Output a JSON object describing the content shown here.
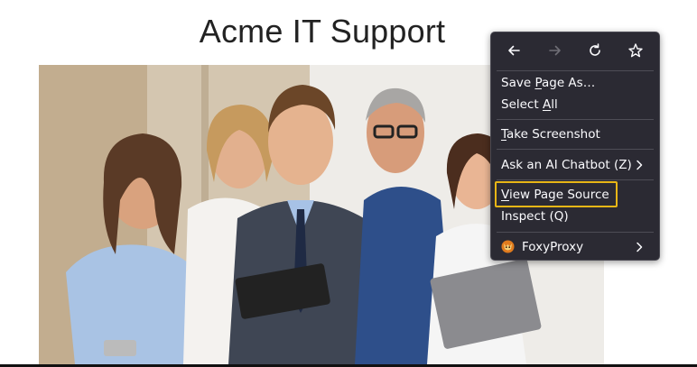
{
  "page": {
    "title": "Acme IT Support"
  },
  "context_menu": {
    "nav": [
      "back-icon",
      "forward-icon",
      "reload-icon",
      "bookmark-star-icon"
    ],
    "items": {
      "save_page": {
        "pre": "Save ",
        "acc": "P",
        "post": "age As…"
      },
      "select_all": {
        "pre": "Select ",
        "acc": "A",
        "post": "ll"
      },
      "screenshot": {
        "pre": "",
        "acc": "T",
        "post": "ake Screenshot"
      },
      "ai_chatbot": {
        "label": "Ask an AI Chatbot (Z)"
      },
      "view_source": {
        "pre": "",
        "acc": "V",
        "post": "iew Page Source"
      },
      "inspect": {
        "label": "Inspect (Q)"
      },
      "foxyproxy": {
        "label": "FoxyProxy"
      }
    },
    "highlighted_item": "View Page Source",
    "highlight_color": "#e8b616"
  }
}
